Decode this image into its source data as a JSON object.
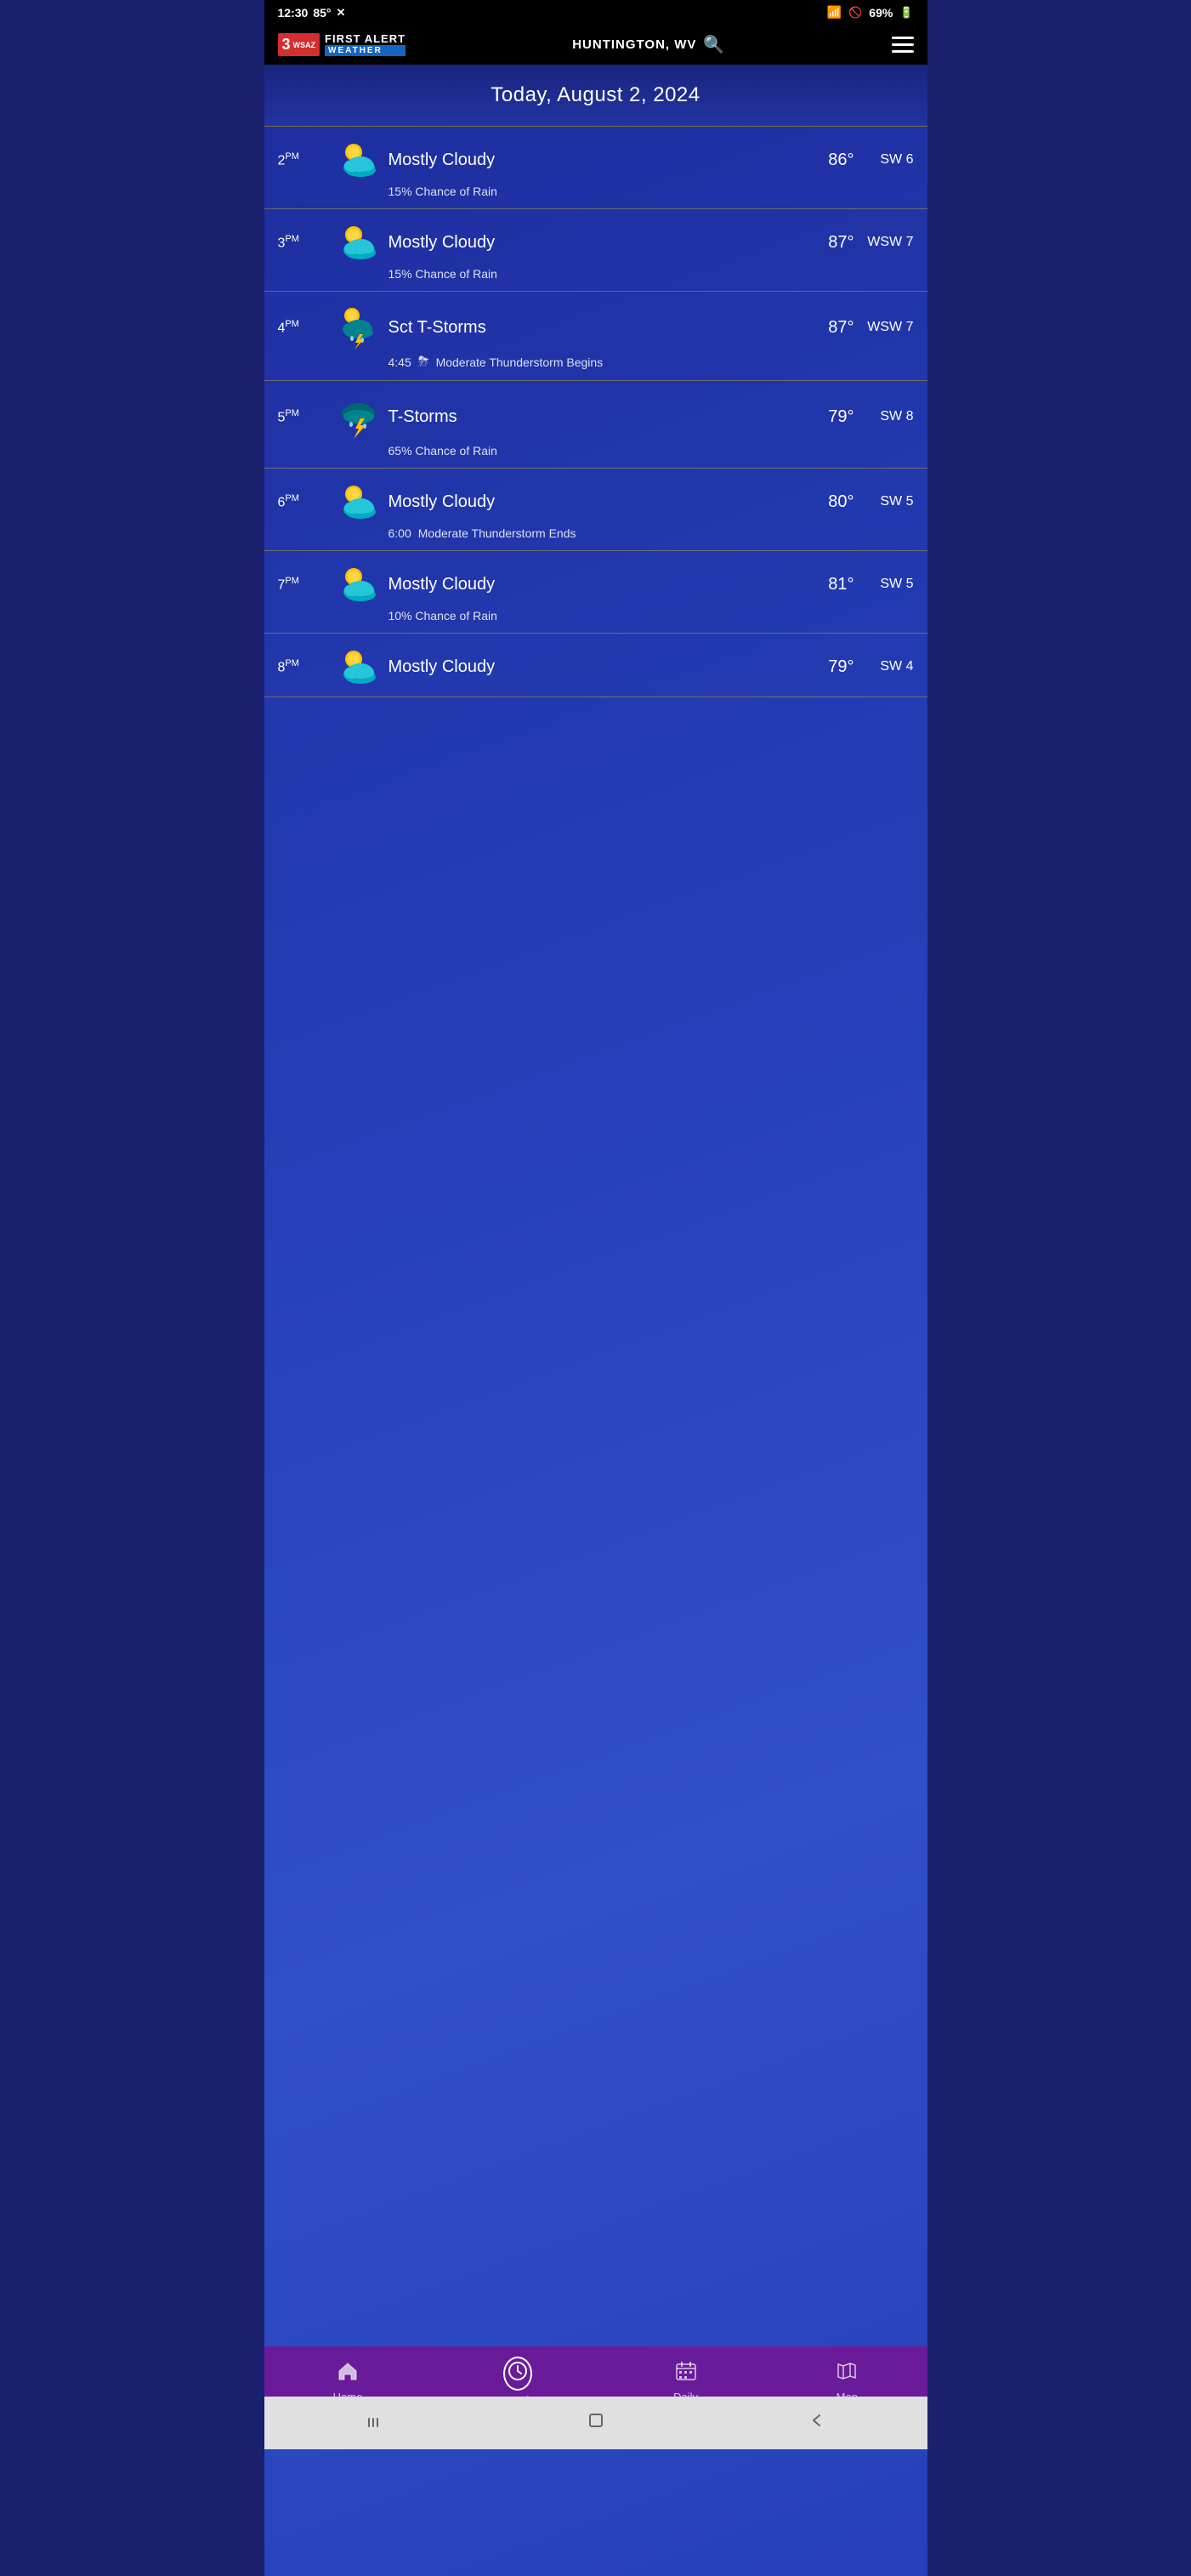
{
  "statusBar": {
    "time": "12:30",
    "temp": "85°",
    "battery": "69%"
  },
  "header": {
    "location": "HUNTINGTON, WV",
    "logoChannel": "3",
    "logoTop": "WSAZ",
    "firstAlert": "FIRST ALERT",
    "weather": "WEATHER"
  },
  "dateBanner": {
    "text": "Today, August 2, 2024"
  },
  "hourlyRows": [
    {
      "id": "2pm",
      "hour": "2",
      "ampm": "PM",
      "condition": "Mostly Cloudy",
      "temp": "86°",
      "wind": "SW 6",
      "iconType": "mostly-cloudy",
      "sub": "15% Chance of Rain",
      "subIsEvent": false
    },
    {
      "id": "3pm",
      "hour": "3",
      "ampm": "PM",
      "condition": "Mostly Cloudy",
      "temp": "87°",
      "wind": "WSW 7",
      "iconType": "mostly-cloudy",
      "sub": "15% Chance of Rain",
      "subIsEvent": false
    },
    {
      "id": "4pm",
      "hour": "4",
      "ampm": "PM",
      "condition": "Sct T-Storms",
      "temp": "87°",
      "wind": "WSW 7",
      "iconType": "sct-tstorms",
      "subIsEvent": true,
      "eventTime": "4:45",
      "eventDesc": "Moderate Thunderstorm Begins"
    },
    {
      "id": "5pm",
      "hour": "5",
      "ampm": "PM",
      "condition": "T-Storms",
      "temp": "79°",
      "wind": "SW 8",
      "iconType": "tstorms",
      "sub": "65% Chance of Rain",
      "subIsEvent": false
    },
    {
      "id": "6pm",
      "hour": "6",
      "ampm": "PM",
      "condition": "Mostly Cloudy",
      "temp": "80°",
      "wind": "SW 5",
      "iconType": "mostly-cloudy",
      "subIsEvent": true,
      "eventTime": "6:00",
      "eventDesc": "Moderate Thunderstorm Ends"
    },
    {
      "id": "7pm",
      "hour": "7",
      "ampm": "PM",
      "condition": "Mostly Cloudy",
      "temp": "81°",
      "wind": "SW 5",
      "iconType": "mostly-cloudy",
      "sub": "10% Chance of Rain",
      "subIsEvent": false
    },
    {
      "id": "8pm",
      "hour": "8",
      "ampm": "PM",
      "condition": "Mostly Cloudy",
      "temp": "79°",
      "wind": "SW 4",
      "iconType": "mostly-cloudy",
      "sub": "",
      "subIsEvent": false
    }
  ],
  "bottomNav": {
    "items": [
      {
        "id": "home",
        "label": "Home",
        "icon": "home"
      },
      {
        "id": "hourly",
        "label": "Hourly",
        "icon": "clock",
        "active": true
      },
      {
        "id": "daily",
        "label": "Daily",
        "icon": "calendar"
      },
      {
        "id": "map",
        "label": "Map",
        "icon": "map"
      }
    ]
  }
}
